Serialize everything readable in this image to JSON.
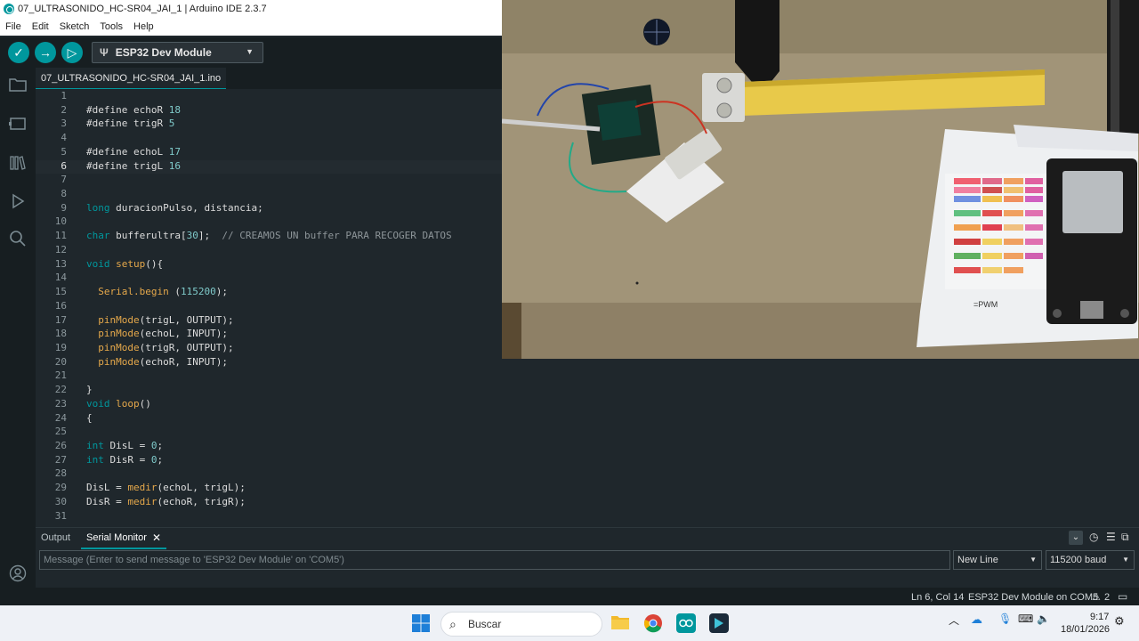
{
  "window": {
    "title": "07_ULTRASONIDO_HC-SR04_JAI_1 | Arduino IDE 2.3.7"
  },
  "menu": [
    "File",
    "Edit",
    "Sketch",
    "Tools",
    "Help"
  ],
  "toolbar": {
    "board": "ESP32 Dev Module"
  },
  "editor_tab": "07_ULTRASONIDO_HC-SR04_JAI_1.ino",
  "code_lines": [
    {
      "n": "1",
      "t": ""
    },
    {
      "n": "2",
      "t": "#define echoR 18"
    },
    {
      "n": "3",
      "t": "#define trigR 5"
    },
    {
      "n": "4",
      "t": ""
    },
    {
      "n": "5",
      "t": "#define echoL 17"
    },
    {
      "n": "6",
      "t": "#define trigL 16"
    },
    {
      "n": "7",
      "t": ""
    },
    {
      "n": "8",
      "t": ""
    },
    {
      "n": "9",
      "t": "long duracionPulso, distancia;"
    },
    {
      "n": "10",
      "t": ""
    },
    {
      "n": "11",
      "t": "char bufferultra[30];  // CREAMOS UN buffer PARA RECOGER DATOS"
    },
    {
      "n": "12",
      "t": ""
    },
    {
      "n": "13",
      "t": "void setup(){"
    },
    {
      "n": "14",
      "t": ""
    },
    {
      "n": "15",
      "t": "  Serial.begin (115200);"
    },
    {
      "n": "16",
      "t": ""
    },
    {
      "n": "17",
      "t": "  pinMode(trigL, OUTPUT);"
    },
    {
      "n": "18",
      "t": "  pinMode(echoL, INPUT);"
    },
    {
      "n": "19",
      "t": "  pinMode(trigR, OUTPUT);"
    },
    {
      "n": "20",
      "t": "  pinMode(echoR, INPUT);"
    },
    {
      "n": "21",
      "t": ""
    },
    {
      "n": "22",
      "t": "}"
    },
    {
      "n": "23",
      "t": "void loop()"
    },
    {
      "n": "24",
      "t": "{"
    },
    {
      "n": "25",
      "t": ""
    },
    {
      "n": "26",
      "t": "int DisL = 0;"
    },
    {
      "n": "27",
      "t": "int DisR = 0;"
    },
    {
      "n": "28",
      "t": ""
    },
    {
      "n": "29",
      "t": "DisL = medir(echoL, trigL);"
    },
    {
      "n": "30",
      "t": "DisR = medir(echoR, trigR);"
    },
    {
      "n": "31",
      "t": ""
    }
  ],
  "serial": {
    "tab_output": "Output",
    "tab_serial": "Serial Monitor",
    "placeholder": "Message (Enter to send message to 'ESP32 Dev Module' on 'COM5')",
    "line_ending": "New Line",
    "baud": "115200 baud"
  },
  "status": {
    "position": "Ln 6, Col 14",
    "board_port": "ESP32 Dev Module on COM5",
    "notifications": "2"
  },
  "taskbar": {
    "search": "Buscar",
    "time": "9:17",
    "date": "18/01/2026"
  },
  "photo": {
    "pinout_label": "=PWM"
  }
}
